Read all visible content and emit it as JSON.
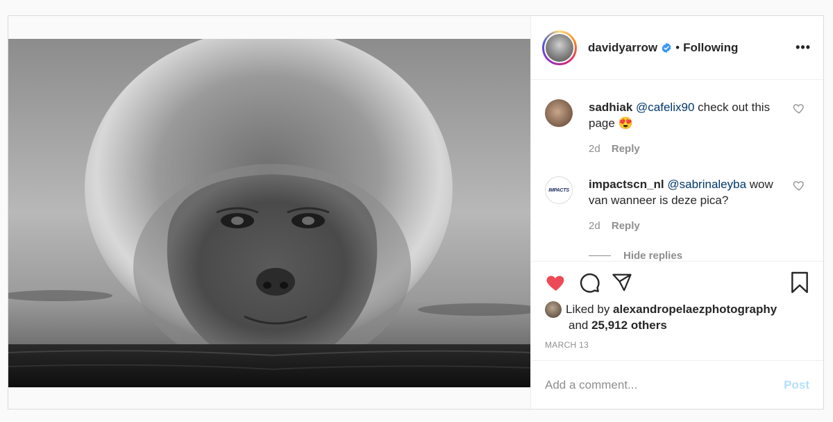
{
  "post": {
    "image_alt": "Black and white photo of a snow monkey with frosty wet fur sitting in water",
    "author": {
      "username": "davidyarrow",
      "follow_status": "Following",
      "separator": "•",
      "more_label": "•••"
    },
    "comments": [
      {
        "username": "sadhiak",
        "mention": "@cafelix90",
        "text_after_mention": " check out this page ",
        "emoji": "😍",
        "age": "2d",
        "reply_label": "Reply"
      },
      {
        "username": "impactscn_nl",
        "mention": "@sabrinaleyba",
        "text_after_mention": " wow van wanneer is deze pica?",
        "emoji": "",
        "age": "2d",
        "reply_label": "Reply",
        "avatar_text": "IMPACTS"
      }
    ],
    "hide_replies_label": "Hide replies",
    "likes": {
      "prefix": "Liked by ",
      "liker": "alexandropelaezphotography",
      "and": "and ",
      "others": "25,912 others"
    },
    "date": "MARCH 13",
    "add_comment": {
      "placeholder": "Add a comment...",
      "post_label": "Post"
    },
    "colors": {
      "heart_liked": "#ed4956",
      "verified": "#3897f0",
      "mention": "#00376b",
      "post_button_disabled": "#b2dffc"
    }
  }
}
